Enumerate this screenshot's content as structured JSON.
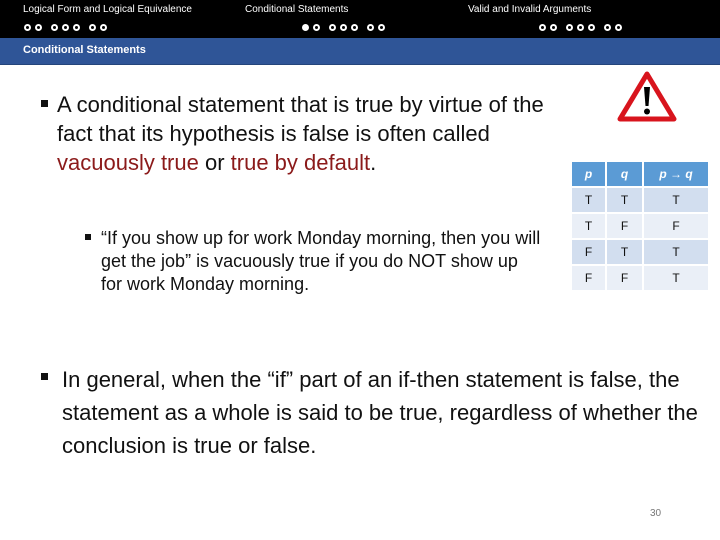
{
  "nav": {
    "sections": [
      {
        "label": "Logical Form and Logical Equivalence",
        "dots": 7,
        "filled": []
      },
      {
        "label": "Conditional Statements",
        "dots": 7,
        "filled": [
          0
        ]
      },
      {
        "label": "Valid and Invalid Arguments",
        "dots": 7,
        "filled": []
      }
    ]
  },
  "slide": {
    "title": "Conditional Statements",
    "bullet1": {
      "text_before": "A conditional statement that is true by virtue of the fact that its hypothesis is false is often called ",
      "highlight1": "vacuously true",
      "middle": " or ",
      "highlight2": "true by default",
      "end": "."
    },
    "bullet2": "“If you show up for work Monday morning, then you will get the job” is vacuously true if you do NOT show up for work Monday morning.",
    "bullet3": "In general, when the “if” part of an if-then statement is false, the statement as a whole is said to be true, regardless of whether the conclusion is true or false.",
    "page_number": "30",
    "warning_icon": "warning-triangle-icon",
    "highlight_color": "#8b1a1a"
  },
  "truth_table": {
    "headers": [
      "p",
      "q",
      "p → q"
    ],
    "rows": [
      [
        "T",
        "T",
        "T"
      ],
      [
        "T",
        "F",
        "F"
      ],
      [
        "F",
        "T",
        "T"
      ],
      [
        "F",
        "F",
        "T"
      ]
    ]
  }
}
